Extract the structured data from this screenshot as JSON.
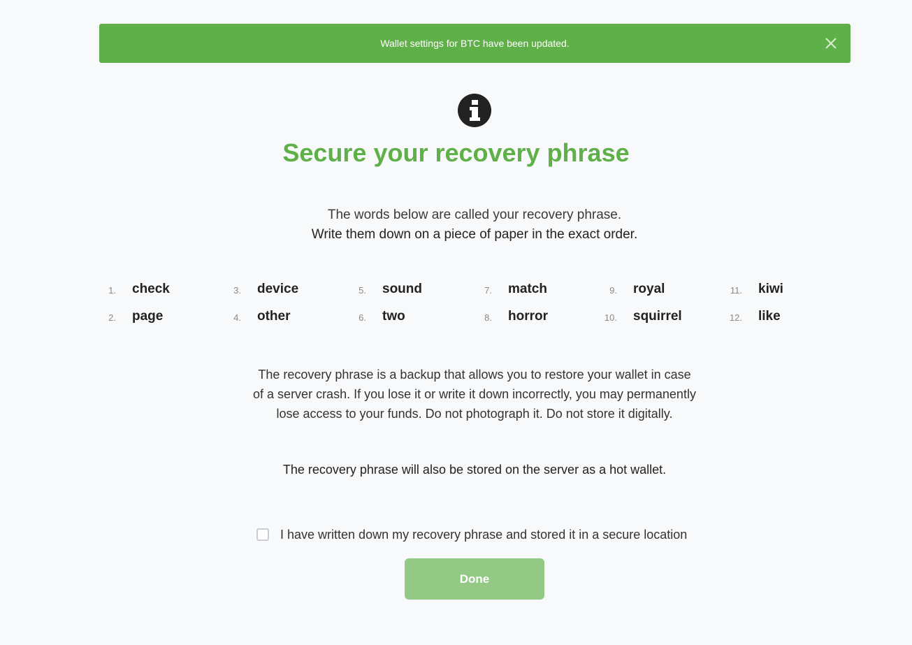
{
  "alert": {
    "message": "Wallet settings for BTC have been updated.",
    "close_icon": "close-icon"
  },
  "header": {
    "icon": "info-icon",
    "title": "Secure your recovery phrase"
  },
  "intro": {
    "line1": "The words below are called your recovery phrase.",
    "line2": "Write them down on a piece of paper in the exact order."
  },
  "words": [
    {
      "num": "1.",
      "word": "check"
    },
    {
      "num": "2.",
      "word": "page"
    },
    {
      "num": "3.",
      "word": "device"
    },
    {
      "num": "4.",
      "word": "other"
    },
    {
      "num": "5.",
      "word": "sound"
    },
    {
      "num": "6.",
      "word": "two"
    },
    {
      "num": "7.",
      "word": "match"
    },
    {
      "num": "8.",
      "word": "horror"
    },
    {
      "num": "9.",
      "word": "royal"
    },
    {
      "num": "10.",
      "word": "squirrel"
    },
    {
      "num": "11.",
      "word": "kiwi"
    },
    {
      "num": "12.",
      "word": "like"
    }
  ],
  "description": "The recovery phrase is a backup that allows you to restore your wallet in case of a server crash. If you lose it or write it down incorrectly, you may permanently lose access to your funds. Do not photograph it. Do not store it digitally.",
  "hot_wallet_note": "The recovery phrase will also be stored on the server as a hot wallet.",
  "confirm": {
    "label": "I have written down my recovery phrase and stored it in a secure location",
    "checked": false
  },
  "done_button": {
    "label": "Done"
  },
  "colors": {
    "accent": "#5fb049",
    "button_disabled": "#93c985",
    "background": "#f8f9fb"
  }
}
